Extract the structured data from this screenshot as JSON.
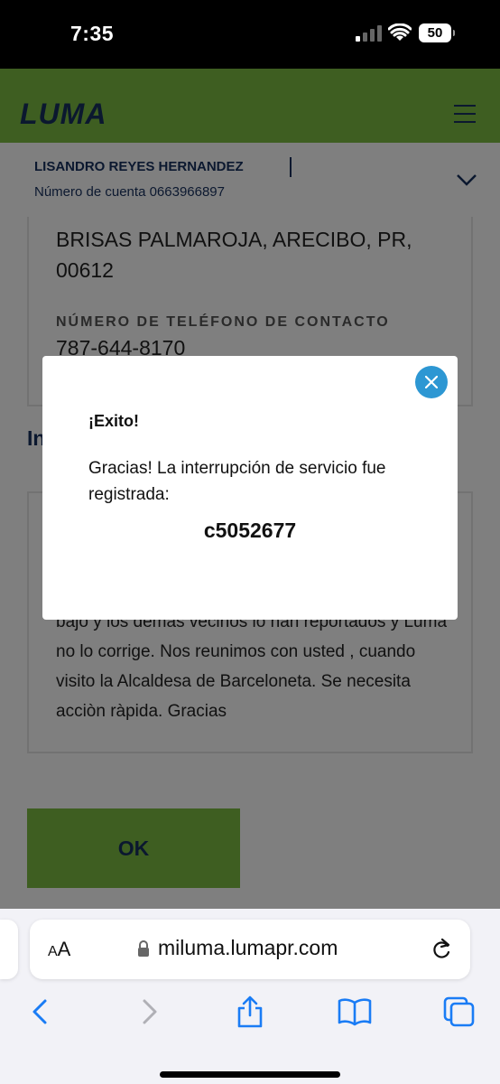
{
  "status_bar": {
    "time": "7:35",
    "battery": "50"
  },
  "header": {
    "logo": "LUMA",
    "menu_icon": "hamburger-menu-icon",
    "brand_color": "#7dbd42",
    "text_color": "#17305f"
  },
  "account": {
    "name": "LISANDRO REYES HERNANDEZ",
    "number_label": "Número de cuenta 0663966897"
  },
  "details": {
    "address": "BRISAS PALMAROJA, ARECIBO, PR, 00612",
    "phone_label": "NÚMERO DE TELÉFONO DE CONTACTO",
    "phone_value": "787-644-8170",
    "section_heading": "In",
    "description": "bajo y los demas vecinos lo han reportados y Luma no lo corrige. Nos reunimos con usted , cuando visito la Alcaldesa de Barceloneta. Se necesita acciòn ràpida. Gracias"
  },
  "ok_button": "OK",
  "modal": {
    "title": "¡Exito!",
    "message": "Gracias! La interrupción de servicio fue registrada:",
    "code": "c5052677",
    "close_color": "#2d97d3"
  },
  "browser": {
    "aa_big": "A",
    "aa_small": "A",
    "url": "miluma.lumapr.com",
    "toolbar_icons": [
      "back-icon",
      "forward-icon",
      "share-icon",
      "bookmarks-icon",
      "tabs-icon"
    ],
    "accent_color": "#1a7cf5"
  }
}
